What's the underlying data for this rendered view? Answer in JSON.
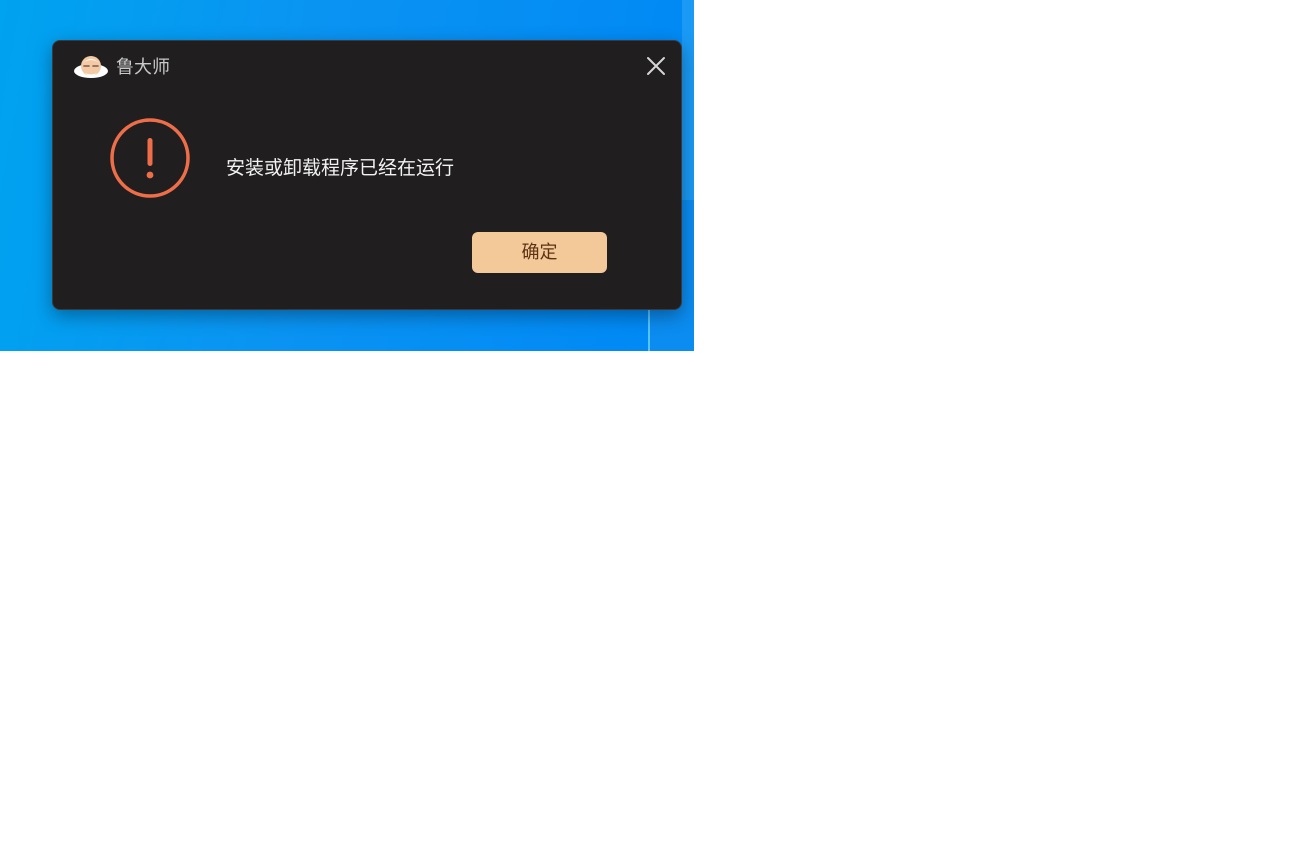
{
  "window": {
    "app_title": "鲁大师",
    "logo_icon": "ludashi-mascot-icon",
    "close_icon": "close-icon"
  },
  "alert": {
    "icon": "warning-exclamation-circle-icon",
    "message": "安装或卸载程序已经在运行"
  },
  "actions": {
    "ok_label": "确定"
  },
  "colors": {
    "dialog_background": "#201e1f",
    "accent_warning": "#ee6e4a",
    "button_background": "#f4c99a",
    "button_text": "#5a3412",
    "desktop_background": "#0a93f2"
  }
}
